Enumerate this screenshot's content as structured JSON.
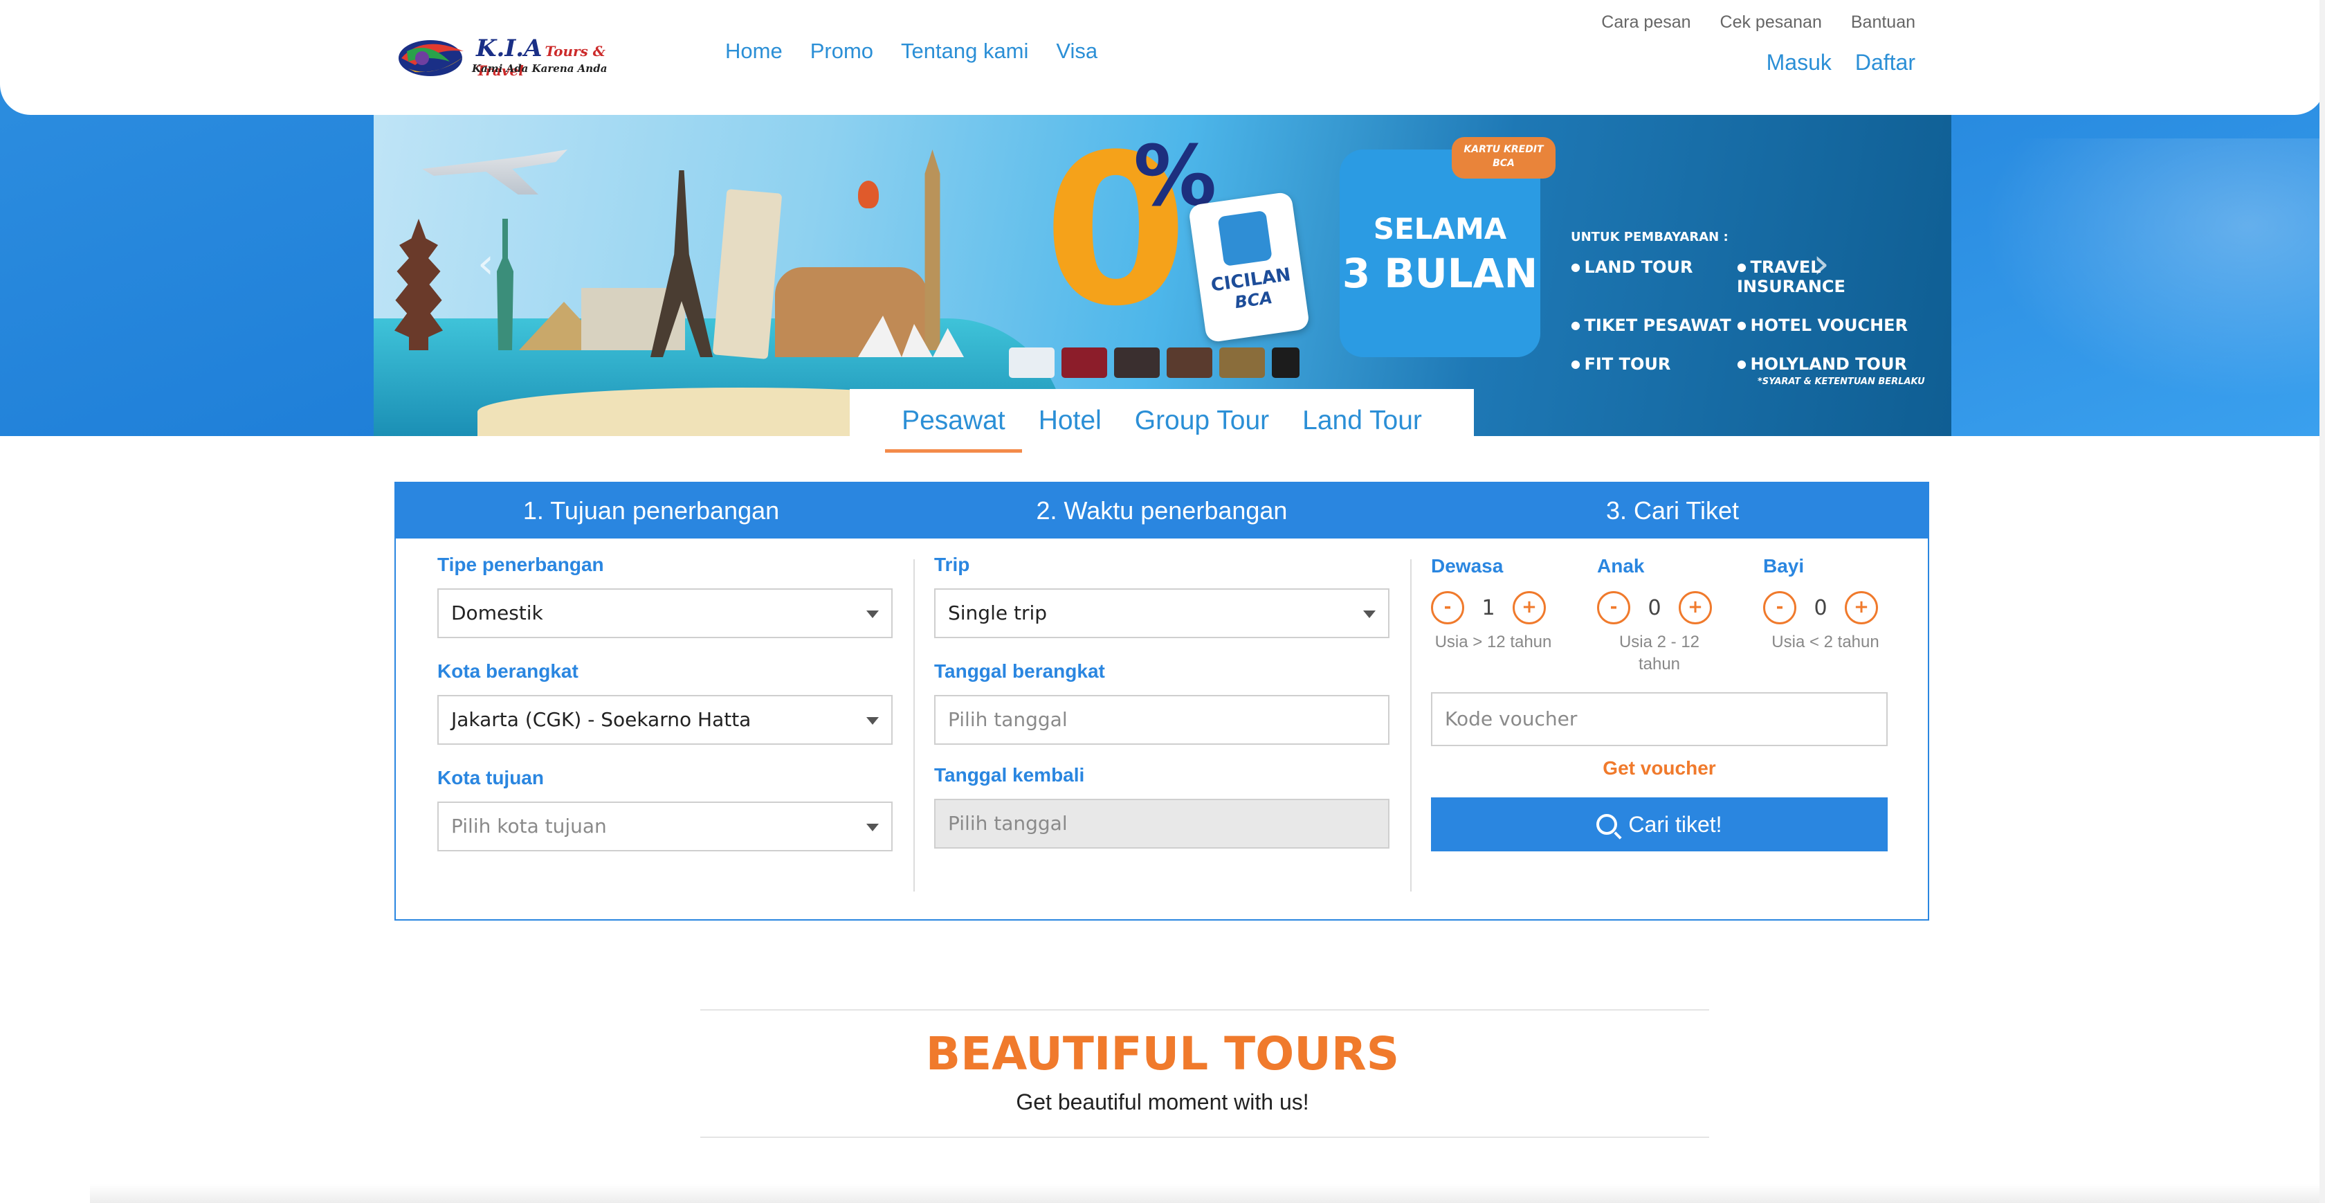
{
  "header": {
    "logo_name": "K.I.A",
    "logo_suffix": "Tours & Travel",
    "logo_tagline": "Kami Ada Karena Anda",
    "main_nav": [
      "Home",
      "Promo",
      "Tentang kami",
      "Visa"
    ],
    "top_nav": [
      "Cara pesan",
      "Cek pesanan",
      "Bantuan"
    ],
    "auth_nav": [
      "Masuk",
      "Daftar"
    ]
  },
  "banner": {
    "zero": "0",
    "percent": "%",
    "cicilan_line1": "CICILAN",
    "cicilan_line2": "BCA",
    "badge_line1": "KARTU KREDIT",
    "badge_line2": "BCA",
    "selama_line1": "SELAMA",
    "selama_line2": "3 BULAN",
    "untuk": "UNTUK PEMBAYARAN :",
    "items": [
      "LAND TOUR",
      "TRAVEL INSURANCE",
      "TIKET PESAWAT",
      "HOTEL VOUCHER",
      "FIT TOUR",
      "HOLYLAND TOUR"
    ],
    "footnote": "*SYARAT & KETENTUAN BERLAKU",
    "prev_icon": "‹",
    "next_icon": "›"
  },
  "product_tabs": [
    "Pesawat",
    "Hotel",
    "Group Tour",
    "Land Tour"
  ],
  "search": {
    "steps": [
      "1. Tujuan penerbangan",
      "2. Waktu penerbangan",
      "3. Cari Tiket"
    ],
    "tipe_label": "Tipe penerbangan",
    "tipe_value": "Domestik",
    "kota_berangkat_label": "Kota berangkat",
    "kota_berangkat_value": "Jakarta (CGK) - Soekarno Hatta",
    "kota_tujuan_label": "Kota tujuan",
    "kota_tujuan_placeholder": "Pilih kota tujuan",
    "trip_label": "Trip",
    "trip_value": "Single trip",
    "tgl_berangkat_label": "Tanggal berangkat",
    "tgl_berangkat_placeholder": "Pilih tanggal",
    "tgl_kembali_label": "Tanggal kembali",
    "tgl_kembali_placeholder": "Pilih tanggal",
    "passengers": [
      {
        "label": "Dewasa",
        "value": "1",
        "age": "Usia > 12 tahun"
      },
      {
        "label": "Anak",
        "value": "0",
        "age": "Usia 2 - 12 tahun"
      },
      {
        "label": "Bayi",
        "value": "0",
        "age": "Usia < 2 tahun"
      }
    ],
    "minus": "-",
    "plus": "+",
    "voucher_placeholder": "Kode voucher",
    "get_voucher": "Get voucher",
    "cari_label": "Cari tiket!"
  },
  "tours": {
    "title": "BEAUTIFUL TOURS",
    "subtitle": "Get beautiful moment with us!"
  },
  "colors": {
    "primary": "#2a86e0",
    "accent": "#f07a2c"
  }
}
